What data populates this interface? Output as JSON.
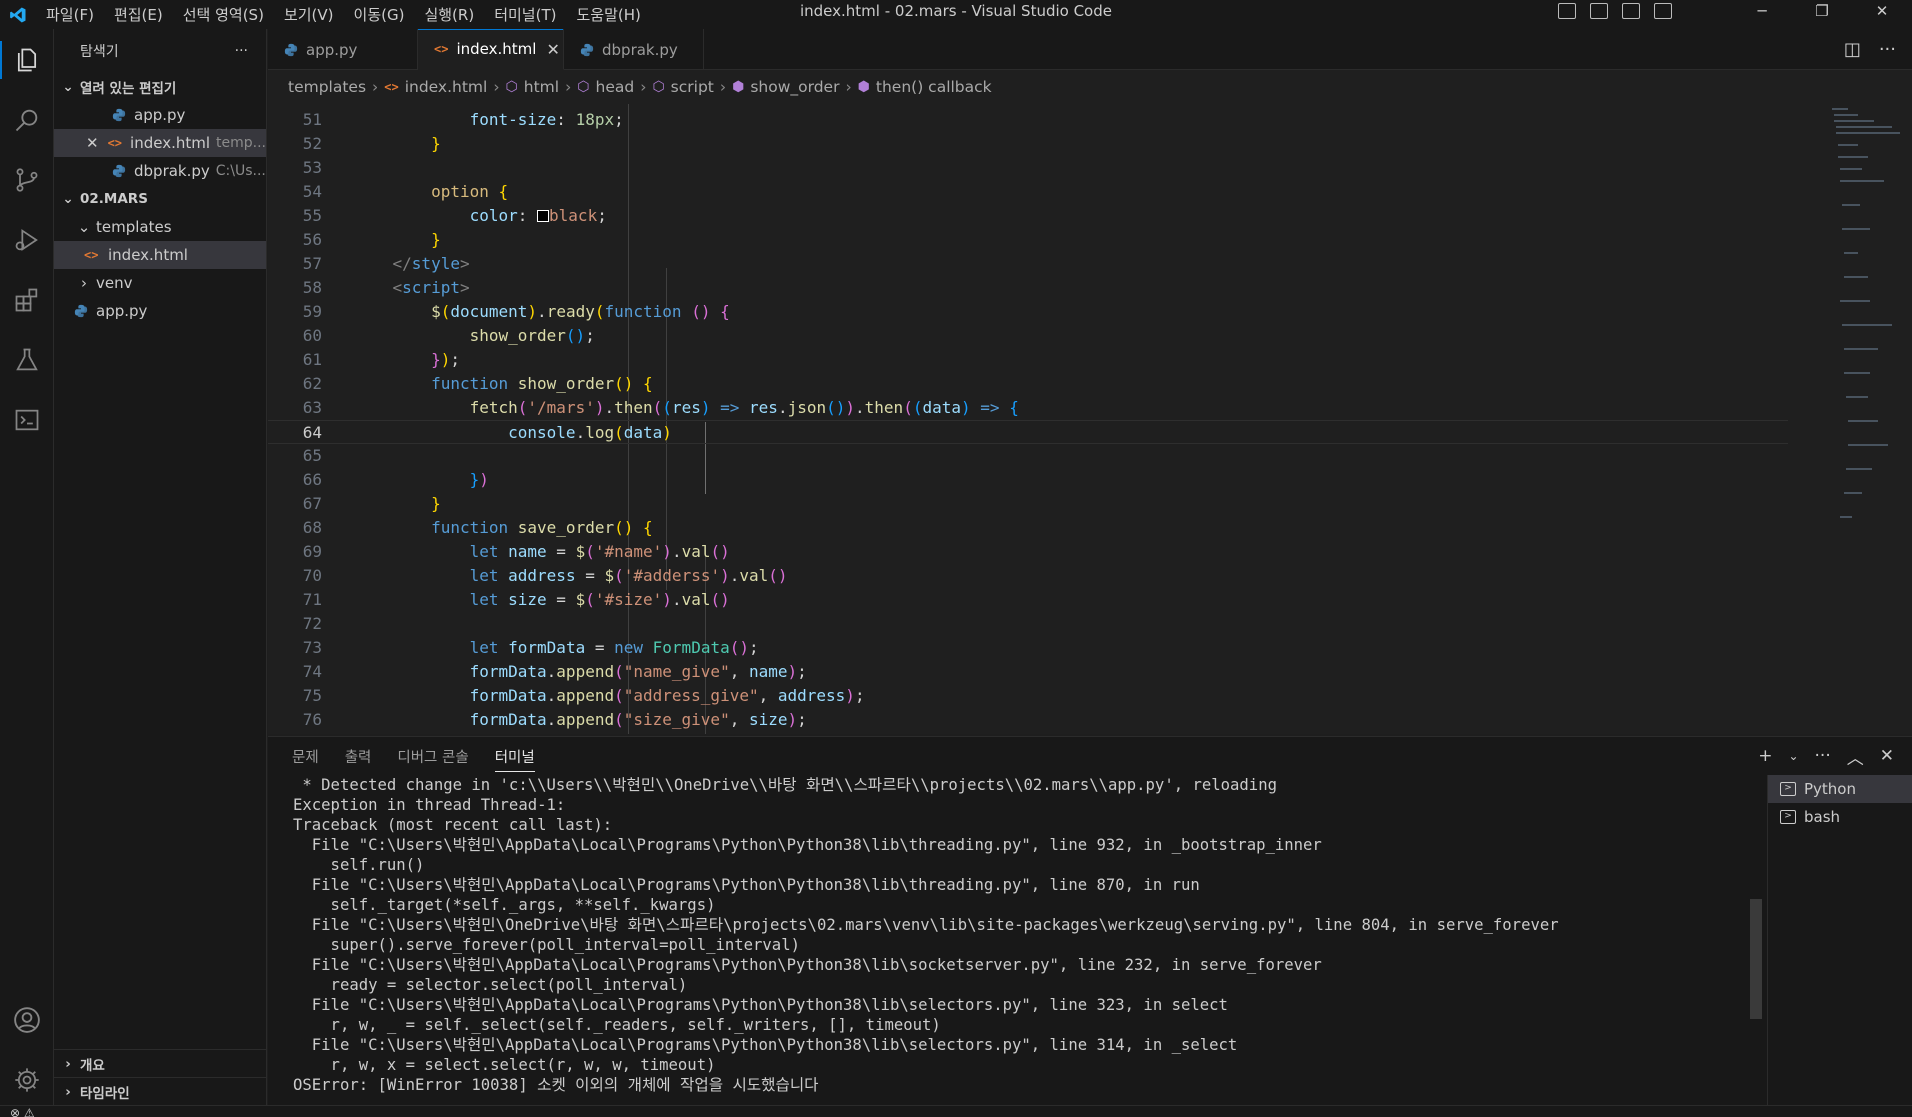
{
  "titlebar": {
    "menu": [
      "파일(F)",
      "편집(E)",
      "선택 영역(S)",
      "보기(V)",
      "이동(G)",
      "실행(R)",
      "터미널(T)",
      "도움말(H)"
    ],
    "window_title": "index.html - 02.mars - Visual Studio Code"
  },
  "sidebar": {
    "title": "탐색기",
    "more": "···",
    "open_editors_label": "열려 있는 편집기",
    "open_editors": [
      {
        "name": "app.py",
        "desc": ""
      },
      {
        "name": "index.html",
        "desc": "temp..."
      },
      {
        "name": "dbprak.py",
        "desc": "C:\\Us..."
      }
    ],
    "project_label": "02.MARS",
    "tree": [
      {
        "name": "templates"
      },
      {
        "name": "index.html"
      },
      {
        "name": "venv"
      },
      {
        "name": "app.py"
      }
    ],
    "outline_label": "개요",
    "timeline_label": "타임라인"
  },
  "tabs": [
    {
      "label": "app.py"
    },
    {
      "label": "index.html"
    },
    {
      "label": "dbprak.py"
    }
  ],
  "breadcrumb": [
    "templates",
    "index.html",
    "html",
    "head",
    "script",
    "show_order",
    "then() callback"
  ],
  "editor": {
    "line_numbers": [
      "51",
      "52",
      "53",
      "54",
      "55",
      "56",
      "57",
      "58",
      "59",
      "60",
      "61",
      "62",
      "63",
      "64",
      "65",
      "66",
      "67",
      "68",
      "69",
      "70",
      "71",
      "72",
      "73",
      "74",
      "75",
      "76"
    ],
    "current_line": "64"
  },
  "panel": {
    "tabs": [
      "문제",
      "출력",
      "디버그 콘솔",
      "터미널"
    ],
    "active_tab": "터미널",
    "terminal_lines": [
      " * Detected change in 'c:\\\\Users\\\\박현민\\\\OneDrive\\\\바탕 화면\\\\스파르타\\\\projects\\\\02.mars\\\\app.py', reloading",
      "Exception in thread Thread-1:",
      "Traceback (most recent call last):",
      "  File \"C:\\Users\\박현민\\AppData\\Local\\Programs\\Python\\Python38\\lib\\threading.py\", line 932, in _bootstrap_inner",
      "    self.run()",
      "  File \"C:\\Users\\박현민\\AppData\\Local\\Programs\\Python\\Python38\\lib\\threading.py\", line 870, in run",
      "    self._target(*self._args, **self._kwargs)",
      "  File \"C:\\Users\\박현민\\OneDrive\\바탕 화면\\스파르타\\projects\\02.mars\\venv\\lib\\site-packages\\werkzeug\\serving.py\", line 804, in serve_forever",
      "    super().serve_forever(poll_interval=poll_interval)",
      "  File \"C:\\Users\\박현민\\AppData\\Local\\Programs\\Python\\Python38\\lib\\socketserver.py\", line 232, in serve_forever",
      "    ready = selector.select(poll_interval)",
      "  File \"C:\\Users\\박현민\\AppData\\Local\\Programs\\Python\\Python38\\lib\\selectors.py\", line 323, in select",
      "    r, w, _ = self._select(self._readers, self._writers, [], timeout)",
      "  File \"C:\\Users\\박현민\\AppData\\Local\\Programs\\Python\\Python38\\lib\\selectors.py\", line 314, in _select",
      "    r, w, x = select.select(r, w, w, timeout)",
      "OSError: [WinError 10038] 소켓 이외의 개체에 작업을 시도했습니다"
    ],
    "terminal_list": [
      "Python",
      "bash"
    ]
  }
}
